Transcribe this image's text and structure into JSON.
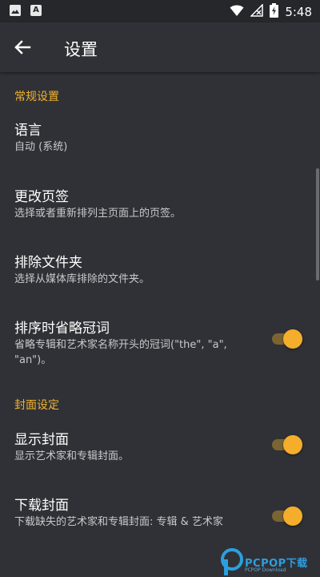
{
  "status_bar": {
    "time": "5:48",
    "notification_icons": [
      "image-icon",
      "a-icon"
    ],
    "status_icons": [
      "wifi-icon",
      "no-signal-icon",
      "battery-charging-icon"
    ]
  },
  "app_bar": {
    "title": "设置",
    "back_icon": "arrow-back-icon"
  },
  "colors": {
    "background": "#303136",
    "accent": "#f0b32e",
    "toggle_on": "#f4ae2b"
  },
  "sections": [
    {
      "header": "常规设置",
      "items": [
        {
          "title": "语言",
          "summary": "自动 (系统)"
        },
        {
          "title": "更改页签",
          "summary": "选择或者重新排列主页面上的页签。"
        },
        {
          "title": "排除文件夹",
          "summary": "选择从媒体库排除的文件夹。"
        },
        {
          "title": "排序时省略冠词",
          "summary": "省略专辑和艺术家名称开头的冠词(\"the\", \"a\", \"an\")。",
          "toggle": true
        }
      ]
    },
    {
      "header": "封面设定",
      "items": [
        {
          "title": "显示封面",
          "summary": "显示艺术家和专辑封面。",
          "toggle": true
        },
        {
          "title": "下载封面",
          "summary": "下载缺失的艺术家和专辑封面: 专辑 & 艺术家",
          "toggle": true
        }
      ]
    }
  ],
  "watermark": {
    "text": "PCPOP下载",
    "subtext": "PCPOP Download"
  }
}
